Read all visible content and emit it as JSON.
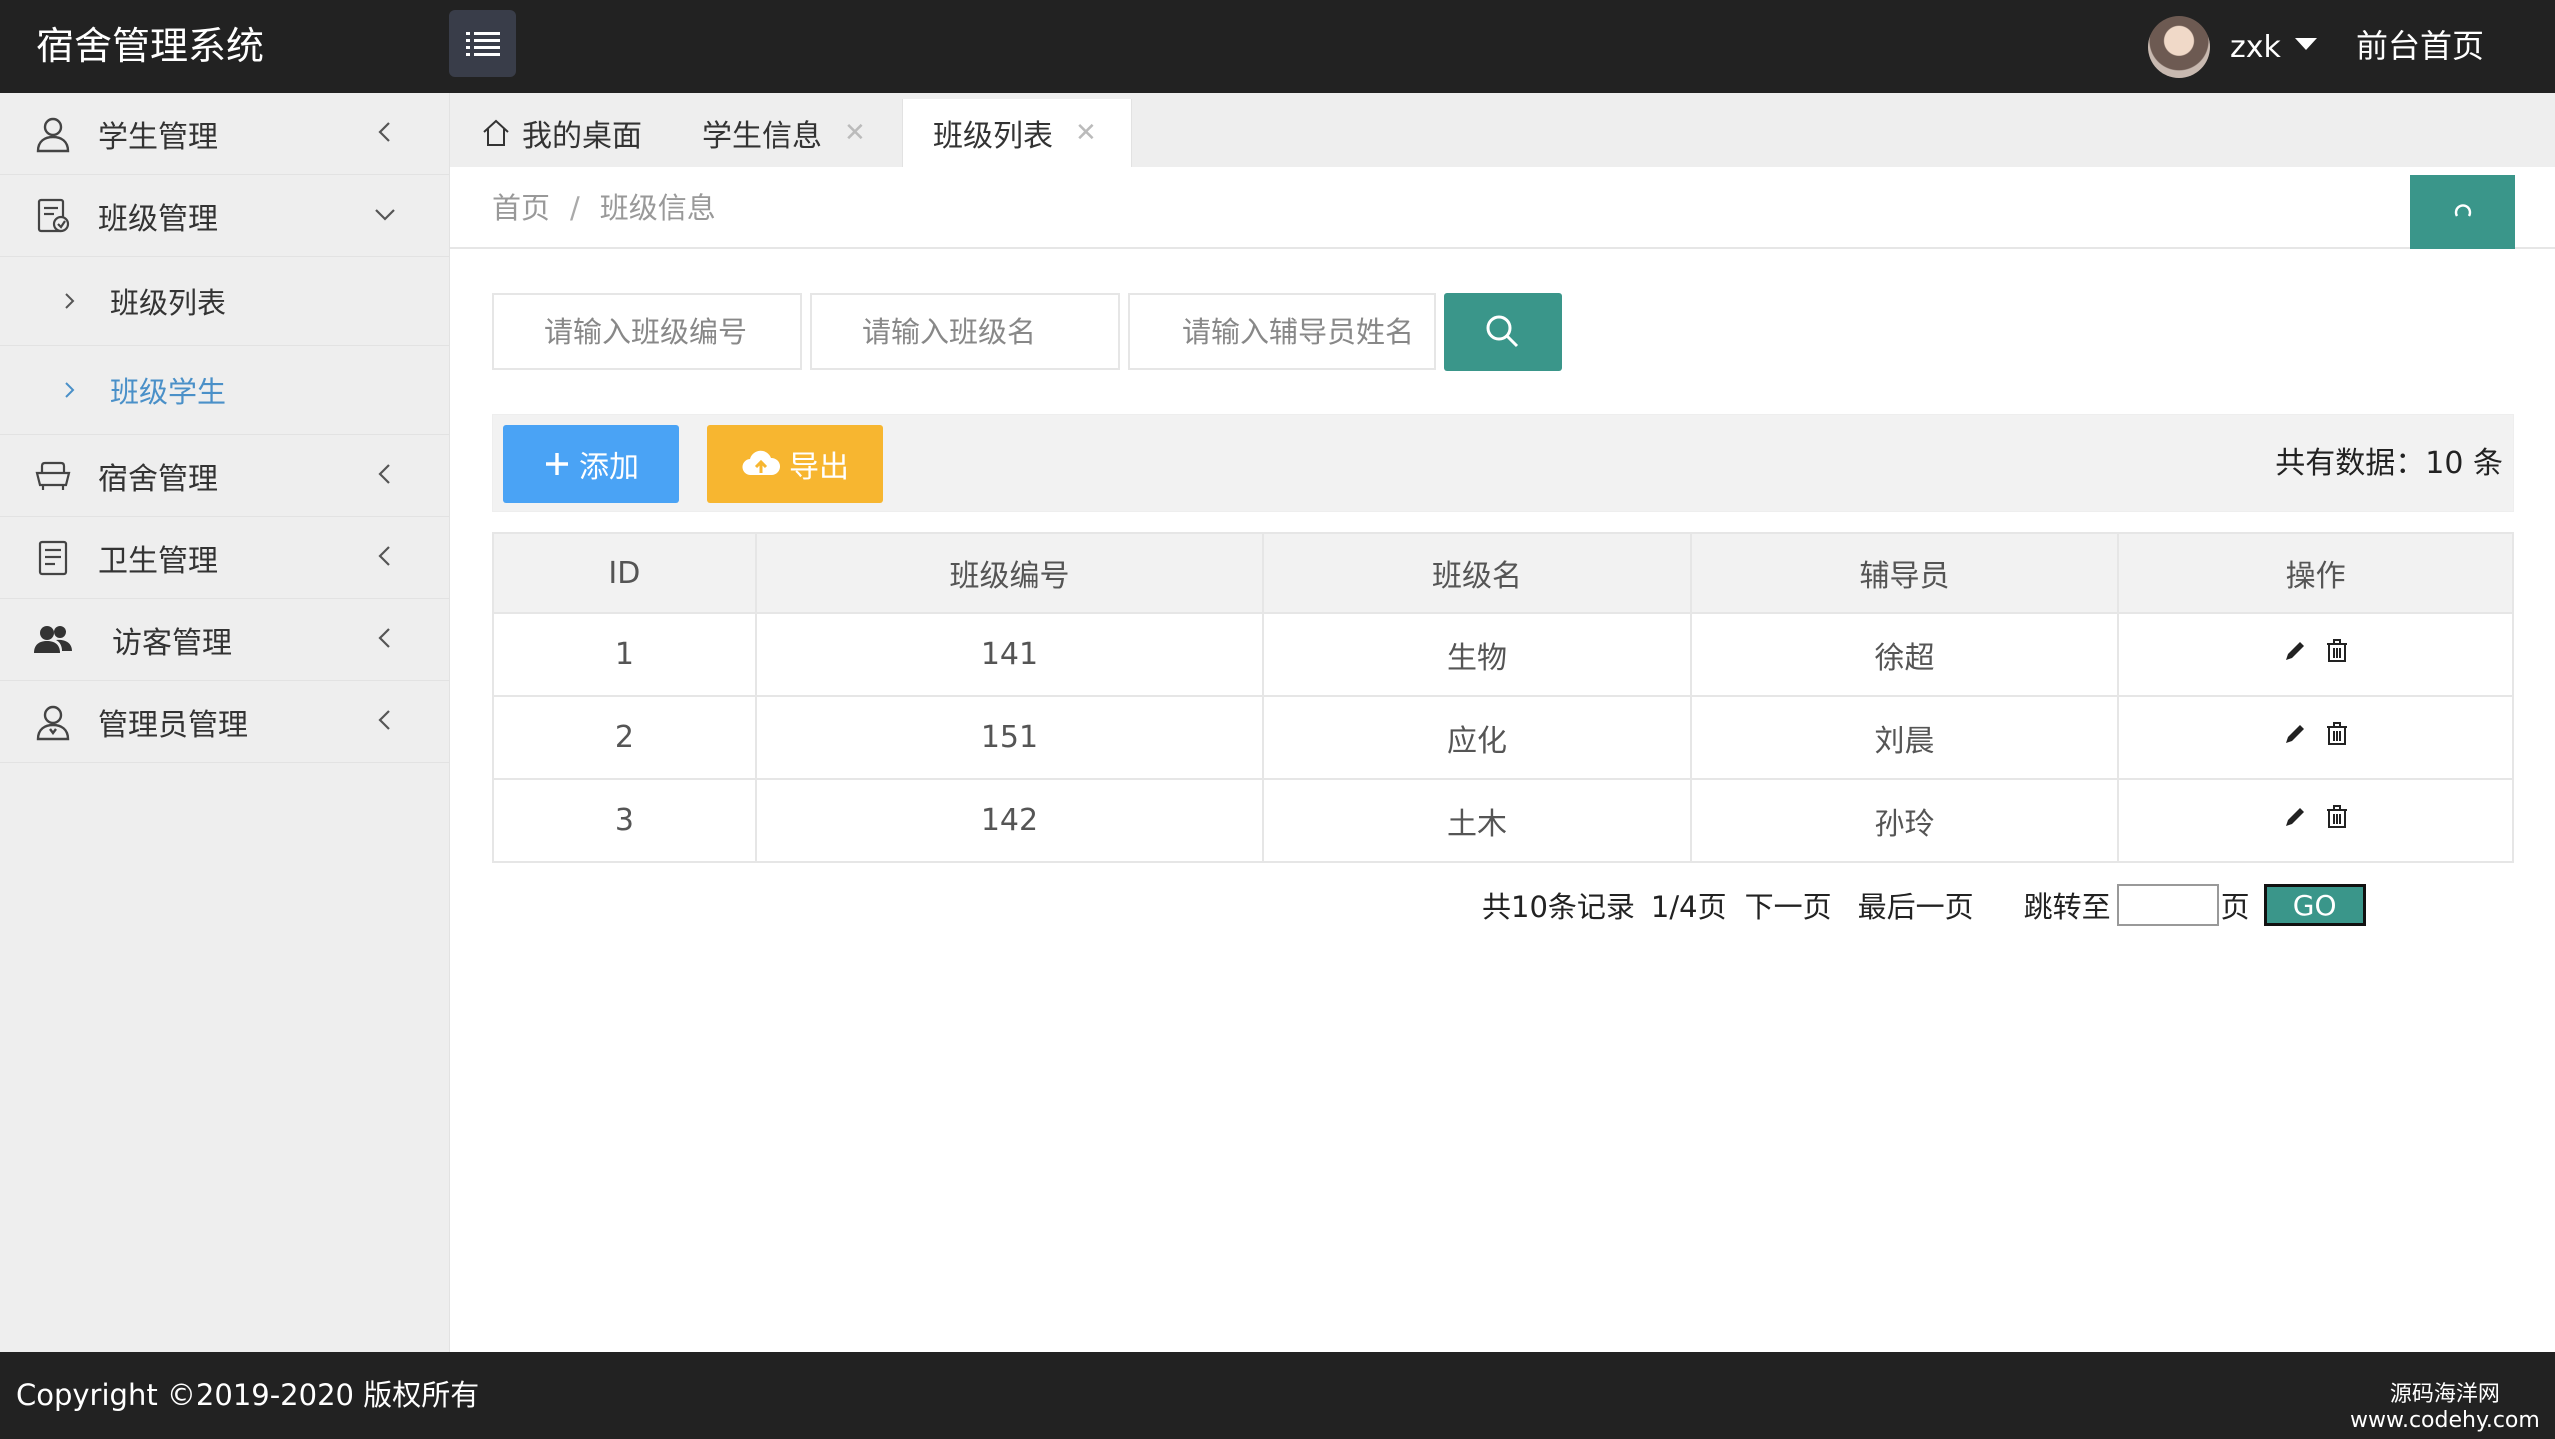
{
  "app": {
    "title": "宿舍管理系统"
  },
  "header": {
    "username": "zxk",
    "front_link": "前台首页"
  },
  "sidebar": {
    "items": [
      {
        "label": "学生管理"
      },
      {
        "label": "班级管理"
      },
      {
        "label": "宿舍管理"
      },
      {
        "label": "卫生管理"
      },
      {
        "label": "访客管理"
      },
      {
        "label": "管理员管理"
      }
    ],
    "sub_items": [
      {
        "label": "班级列表"
      },
      {
        "label": "班级学生"
      }
    ]
  },
  "tabs": [
    {
      "label": "我的桌面"
    },
    {
      "label": "学生信息"
    },
    {
      "label": "班级列表"
    }
  ],
  "breadcrumb": {
    "home": "首页",
    "separator": "/",
    "current": "班级信息"
  },
  "search": {
    "class_no_placeholder": "请输入班级编号",
    "class_name_placeholder": "请输入班级名",
    "counselor_placeholder": "请输入辅导员姓名"
  },
  "toolbar": {
    "add_label": "添加",
    "export_label": "导出",
    "total_text": "共有数据：10 条"
  },
  "table": {
    "headers": [
      "ID",
      "班级编号",
      "班级名",
      "辅导员",
      "操作"
    ],
    "rows": [
      [
        "1",
        "141",
        "生物",
        "徐超"
      ],
      [
        "2",
        "151",
        "应化",
        "刘晨"
      ],
      [
        "3",
        "142",
        "土木",
        "孙玲"
      ]
    ]
  },
  "pager": {
    "records": "共10条记录",
    "page_info": "1/4页",
    "next": "下一页",
    "last": "最后一页",
    "jump_to": "跳转至",
    "page_suffix": "页",
    "go": "GO"
  },
  "footer": {
    "copyright": "Copyright ©2019-2020 版权所有",
    "watermark_line1": "源码海洋网",
    "watermark_line2": "www.codehy.com"
  },
  "colors": {
    "header_bg": "#222222",
    "accent_teal": "#3a968a",
    "add_blue": "#4aa3f5",
    "export_orange": "#f7b630",
    "active_link": "#4a90c8"
  }
}
